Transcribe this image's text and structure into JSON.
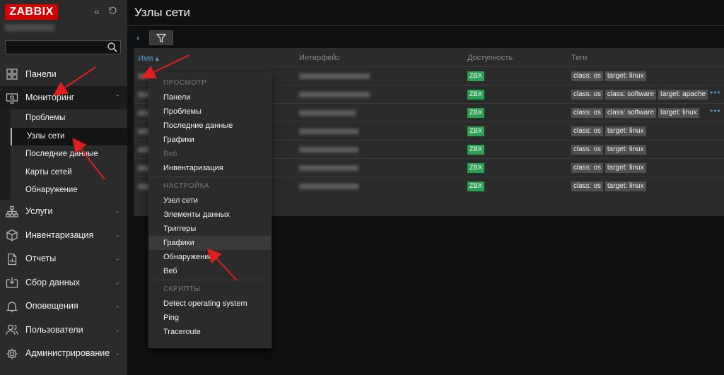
{
  "app": {
    "logo": "ZABBIX"
  },
  "page": {
    "title": "Узлы сети"
  },
  "sidebar": {
    "items": [
      {
        "label": "Панели",
        "icon": "dashboard-icon"
      },
      {
        "label": "Мониторинг",
        "icon": "monitoring-icon",
        "expanded": true
      },
      {
        "label": "Услуги",
        "icon": "services-icon"
      },
      {
        "label": "Инвентаризация",
        "icon": "inventory-icon"
      },
      {
        "label": "Отчеты",
        "icon": "reports-icon"
      },
      {
        "label": "Сбор данных",
        "icon": "data-collection-icon"
      },
      {
        "label": "Оповещения",
        "icon": "alerts-icon"
      },
      {
        "label": "Пользователи",
        "icon": "users-icon"
      },
      {
        "label": "Администрирование",
        "icon": "administration-icon"
      }
    ],
    "monitoring_sub": [
      {
        "label": "Проблемы"
      },
      {
        "label": "Узлы сети",
        "active": true
      },
      {
        "label": "Последние данные"
      },
      {
        "label": "Карты сетей"
      },
      {
        "label": "Обнаружение"
      }
    ]
  },
  "table": {
    "headers": {
      "name": "Имя ▴",
      "interface": "Интерфейс",
      "availability": "Доступность",
      "tags": "Теги"
    },
    "rows": [
      {
        "availability": "ZBX",
        "tags": [
          "class: os",
          "target: linux"
        ],
        "more": false
      },
      {
        "availability": "ZBX",
        "tags": [
          "class: os",
          "class: software",
          "target: apache"
        ],
        "more": true
      },
      {
        "availability": "ZBX",
        "tags": [
          "class: os",
          "class: software",
          "target: linux"
        ],
        "more": true
      },
      {
        "availability": "ZBX",
        "tags": [
          "class: os",
          "target: linux"
        ],
        "more": false
      },
      {
        "availability": "ZBX",
        "tags": [
          "class: os",
          "target: linux"
        ],
        "more": false
      },
      {
        "availability": "ZBX",
        "tags": [
          "class: os",
          "target: linux"
        ],
        "more": false
      },
      {
        "availability": "ZBX",
        "tags": [
          "class: os",
          "target: linux"
        ],
        "more": false
      }
    ],
    "more_label": "•••"
  },
  "context_menu": {
    "sections": [
      {
        "header": "ПРОСМОТР",
        "items": [
          {
            "label": "Панели"
          },
          {
            "label": "Проблемы"
          },
          {
            "label": "Последние данные"
          },
          {
            "label": "Графики"
          },
          {
            "label": "Веб",
            "disabled": true
          },
          {
            "label": "Инвентаризация"
          }
        ]
      },
      {
        "header": "НАСТРОЙКА",
        "items": [
          {
            "label": "Узел сети"
          },
          {
            "label": "Элементы данных"
          },
          {
            "label": "Триггеры"
          },
          {
            "label": "Графики",
            "hover": true
          },
          {
            "label": "Обнаружение"
          },
          {
            "label": "Веб"
          }
        ]
      },
      {
        "header": "СКРИПТЫ",
        "items": [
          {
            "label": "Detect operating system"
          },
          {
            "label": "Ping"
          },
          {
            "label": "Traceroute"
          }
        ]
      }
    ]
  },
  "colors": {
    "accent": "#4796c4",
    "brand": "#d40000",
    "available": "#2aa14f",
    "annotation": "#e02020"
  }
}
